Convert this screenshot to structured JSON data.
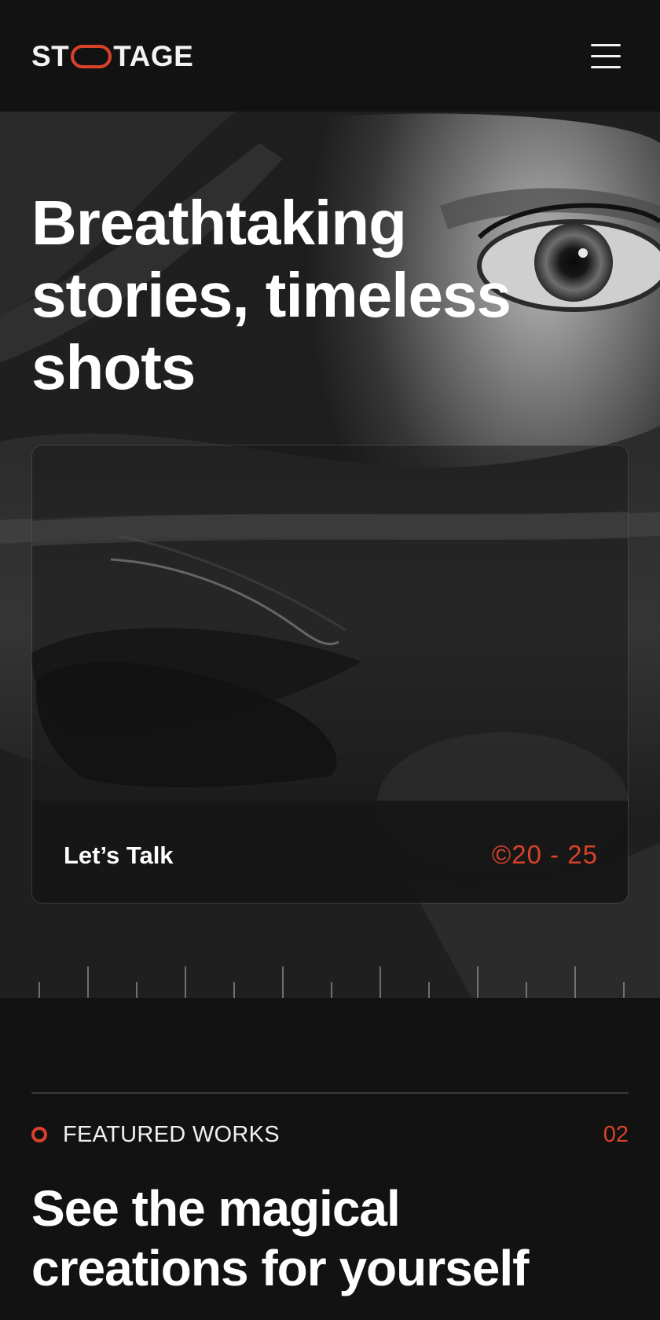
{
  "header": {
    "logo_text_left": "ST",
    "logo_text_right": "TAGE",
    "menu_icon": "hamburger-menu-icon"
  },
  "hero": {
    "title_lines": [
      "Breathtaking",
      "stories, timeless",
      "shots"
    ],
    "card": {
      "label": "Let’s Talk",
      "years": "©20 - 25"
    }
  },
  "featured": {
    "label": "FEATURED WORKS",
    "number": "02",
    "title_lines": [
      "See the magical",
      "creations  for yourself"
    ]
  },
  "colors": {
    "accent": "#d9412b",
    "background": "#121212",
    "text": "#ffffff"
  }
}
